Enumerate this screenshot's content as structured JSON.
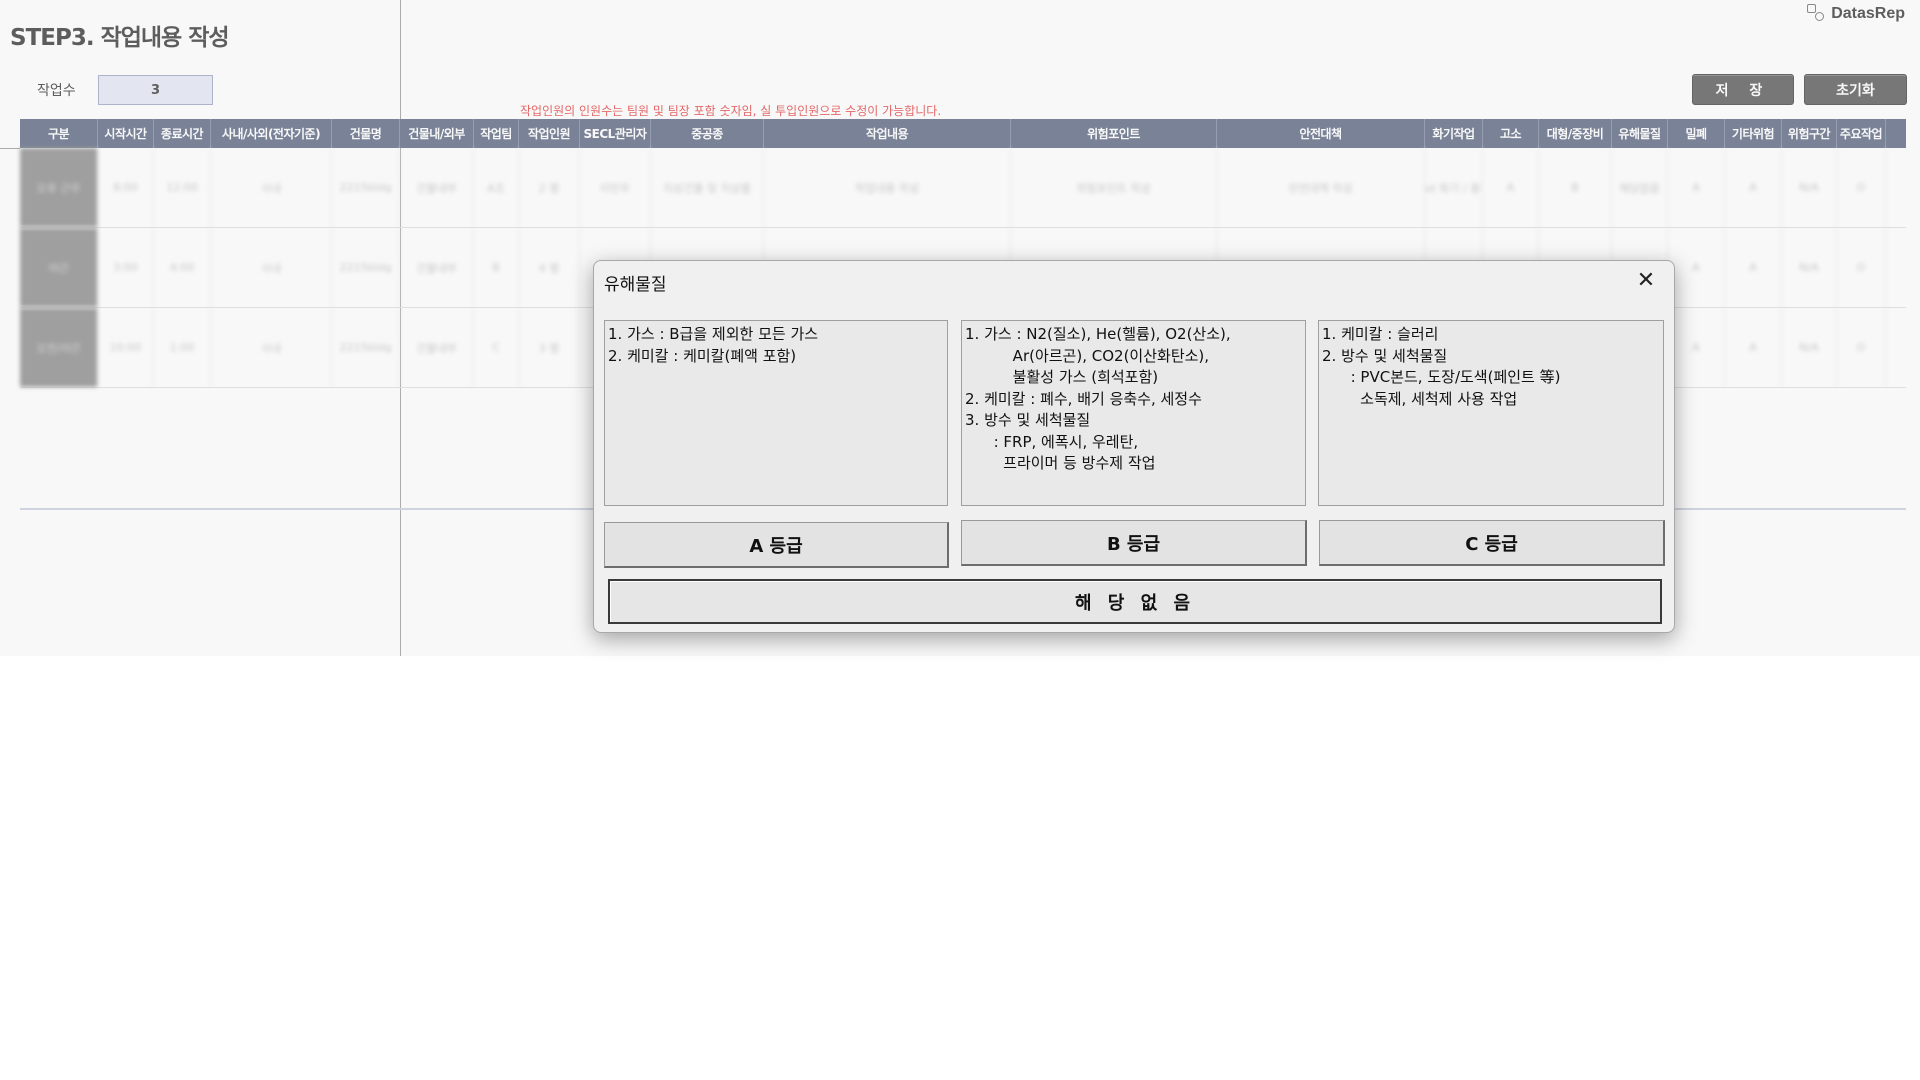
{
  "page": {
    "title": "STEP3. 작업내용 작성",
    "logo_text": "DatasRep",
    "count_label": "작업수",
    "count_value": "3",
    "notice": "작업인원의 인원수는 팀원 및 팀장 포함 숫자임, 실 투입인원으로 수정이 가능합니다.",
    "save_button": "저 장",
    "reset_button": "초기화"
  },
  "table": {
    "headers": [
      "구분",
      "시작시간",
      "종료시간",
      "사내/사외(전자기준)",
      "건물명",
      "건물내/외부",
      "작업팀",
      "작업인원",
      "SECL관리자",
      "중공종",
      "작업내용",
      "위험포인트",
      "안전대책",
      "화기작업",
      "고소",
      "대형/중장비",
      "유해물질",
      "밀폐",
      "기타위험",
      "위험구간",
      "주요작업"
    ],
    "rows": [
      [
        "오후 근무",
        "8:00",
        "12:00",
        "사내",
        "2215bldg",
        "건물내부",
        "A조",
        "2 명",
        "이민우",
        "지상건물 및 지상물",
        "작업내용 작성",
        "위험포인트 작성",
        "안전대책 작성",
        "Hot 화기 / 용접",
        "A",
        "B",
        "해당없음",
        "A",
        "A",
        "N/A",
        "O"
      ],
      [
        "야간",
        "3:00",
        "4:00",
        "사내",
        "2215bldg",
        "건물내부",
        "B",
        "4 명",
        "",
        "",
        "",
        "",
        "",
        "",
        "",
        "",
        "",
        "A",
        "A",
        "N/A",
        "O"
      ],
      [
        "오전/야간",
        "10:00",
        "1:00",
        "사내",
        "2215bldg",
        "건물내부",
        "C",
        "3 명",
        "",
        "",
        "",
        "",
        "",
        "",
        "",
        "",
        "",
        "A",
        "A",
        "N/A",
        "O"
      ]
    ]
  },
  "dialog": {
    "title": "유해물질",
    "close_icon": "close-icon",
    "grade_a_desc": "1. 가스 : B급을 제외한 모든 가스\n2. 케미칼 : 케미칼(폐액 포함)",
    "grade_b_desc": "1. 가스 : N2(질소), He(헬륨), O2(산소),\n          Ar(아르곤), CO2(이산화탄소),\n          불활성 가스 (희석포함)\n2. 케미칼 : 폐수, 배기 응축수, 세정수\n3. 방수 및 세척물질\n      : FRP, 에폭시, 우레탄,\n        프라이머 등 방수제 작업",
    "grade_c_desc": "1. 케미칼 : 슬러리\n2. 방수 및 세척물질\n      : PVC본드, 도장/도색(페인트 等)\n        소독제, 세척제 사용 작업",
    "grade_a_button": "A 등급",
    "grade_b_button": "B 등급",
    "grade_c_button": "C 등급",
    "none_button": "해 당 없 음"
  }
}
